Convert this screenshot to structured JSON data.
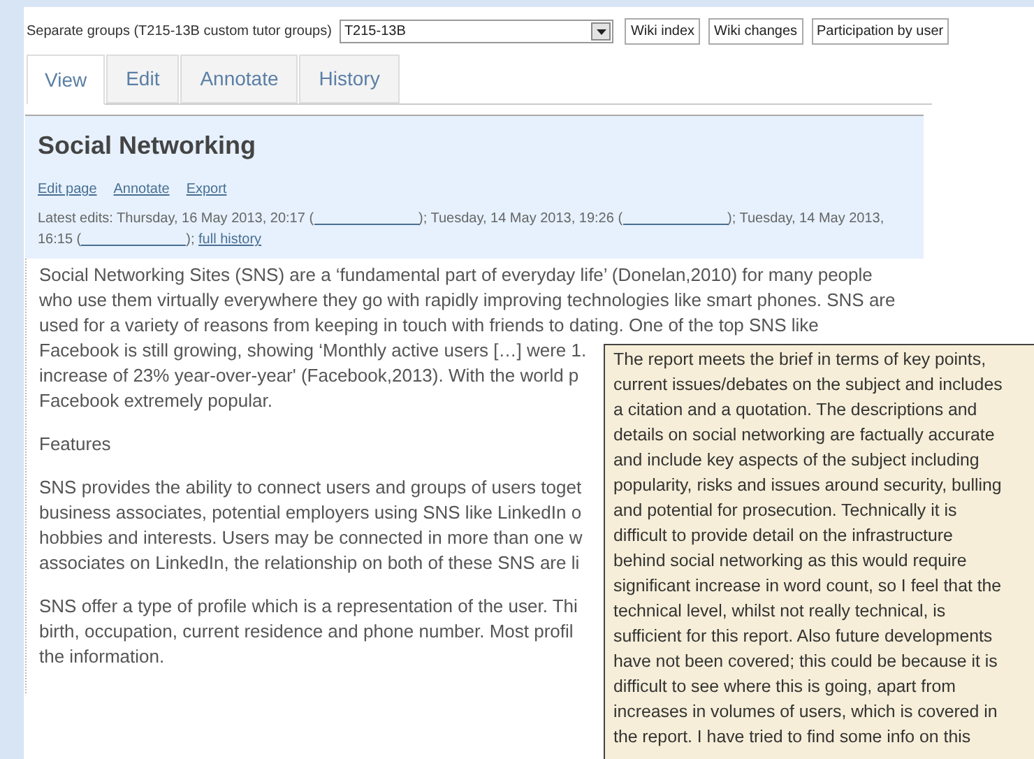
{
  "group_selector": {
    "label": "Separate groups (T215-13B custom tutor groups)",
    "value": "T215-13B"
  },
  "buttons": [
    "Wiki index",
    "Wiki changes",
    "Participation by user"
  ],
  "tabs": [
    {
      "label": "View",
      "selected": true
    },
    {
      "label": "Edit",
      "selected": false
    },
    {
      "label": "Annotate",
      "selected": false
    },
    {
      "label": "History",
      "selected": false
    }
  ],
  "page": {
    "title": "Social Networking",
    "actions": [
      "Edit page",
      "Annotate",
      "Export"
    ],
    "edits_parts": [
      {
        "kind": "text",
        "text": "Latest edits: Thursday, 16 May 2013, 20:17 ("
      },
      {
        "kind": "redacted"
      },
      {
        "kind": "text",
        "text": "); Tuesday, 14 May 2013, 19:26 ("
      },
      {
        "kind": "redacted"
      },
      {
        "kind": "text",
        "text": "); Tuesday, 14 May 2013, 16:15 ("
      },
      {
        "kind": "redacted"
      },
      {
        "kind": "text",
        "text": "); "
      },
      {
        "kind": "link",
        "text": "full history"
      }
    ],
    "paragraphs": [
      {
        "lines": [
          "Social Networking Sites (SNS) are a ‘fundamental part of everyday life’ (Donelan,2010) for many people",
          "who use them virtually everywhere they go with rapidly improving technologies like smart phones. SNS are",
          "used for a variety of reasons from keeping in touch with friends to dating. One of the top SNS like",
          "Facebook is still growing, showing ‘Monthly active users […] were 1.",
          "increase of 23% year-over-year' (Facebook,2013). With the world p",
          "Facebook extremely popular."
        ]
      },
      {
        "lines": [
          "Features"
        ]
      },
      {
        "lines": [
          "SNS provides the ability to connect users and groups of users toget",
          "business associates, potential employers using SNS like LinkedIn o",
          "hobbies and interests. Users may be connected in more than one w",
          "associates on LinkedIn, the relationship on both of these SNS are li"
        ]
      },
      {
        "lines": [
          "SNS offer a type of profile which is a representation of the user. Thi",
          "birth, occupation, current residence and phone number. Most profil",
          "the information."
        ]
      }
    ]
  },
  "annotation": {
    "lines": [
      "The report meets the brief in terms of key points,",
      "current issues/debates on the subject and includes",
      "a citation and a quotation. The descriptions and",
      "details on social networking are factually accurate",
      "and include key aspects of the subject including",
      "popularity, risks and issues around security, bulling",
      "and potential for prosecution. Technically it is",
      "difficult to provide detail on the infrastructure",
      "behind social networking as this would require",
      "significant increase in word count, so I feel that the",
      "technical level, whilst not really technical, is",
      "sufficient for this report. Also future developments",
      "have not been covered; this could be because it is",
      "difficult to see where this is going, apart from",
      "increases in volumes of users, which is covered in",
      "the report. I have tried to find some info on this"
    ]
  }
}
